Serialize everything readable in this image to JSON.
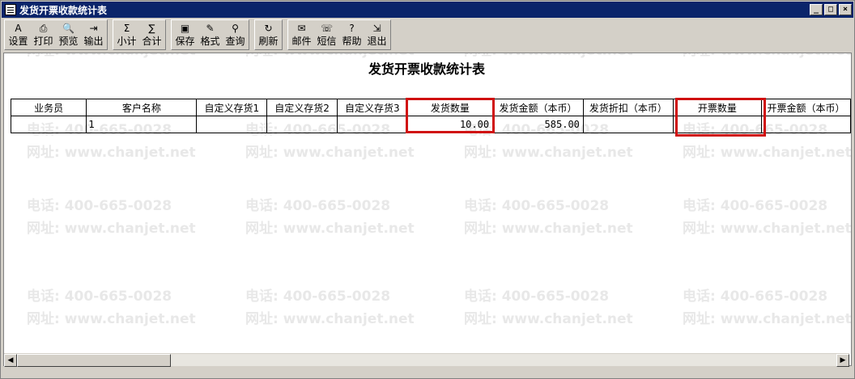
{
  "window": {
    "title": "发货开票收款统计表",
    "controls": [
      "_",
      "□",
      "×"
    ]
  },
  "toolbar": {
    "groups": [
      [
        {
          "label": "设置",
          "icon": "A"
        },
        {
          "label": "打印",
          "icon": "⎙"
        },
        {
          "label": "预览",
          "icon": "🔍"
        },
        {
          "label": "输出",
          "icon": "⇥"
        }
      ],
      [
        {
          "label": "小计",
          "icon": "Σ"
        },
        {
          "label": "合计",
          "icon": "∑"
        }
      ],
      [
        {
          "label": "保存",
          "icon": "▣"
        },
        {
          "label": "格式",
          "icon": "✎"
        },
        {
          "label": "查询",
          "icon": "⚲"
        }
      ],
      [
        {
          "label": "刷新",
          "icon": "↻"
        }
      ],
      [
        {
          "label": "邮件",
          "icon": "✉"
        },
        {
          "label": "短信",
          "icon": "☏"
        },
        {
          "label": "帮助",
          "icon": "?"
        },
        {
          "label": "退出",
          "icon": "⇲"
        }
      ]
    ]
  },
  "report": {
    "title": "发货开票收款统计表",
    "columns": [
      "业务员",
      "客户名称",
      "自定义存货1",
      "自定义存货2",
      "自定义存货3",
      "发货数量",
      "发货金额（本币）",
      "发货折扣（本币）",
      "开票数量",
      "开票金额（本币）"
    ],
    "rows": [
      [
        "",
        "1",
        "",
        "",
        "",
        "10.00",
        "585.00",
        "",
        "",
        ""
      ]
    ]
  },
  "watermark": {
    "phone": "电话: 400-665-0028",
    "site": "网址: www.chanjet.net"
  },
  "colors": {
    "titlebar": "#0a246a",
    "highlight": "#d01010",
    "face": "#d4d0c8"
  }
}
